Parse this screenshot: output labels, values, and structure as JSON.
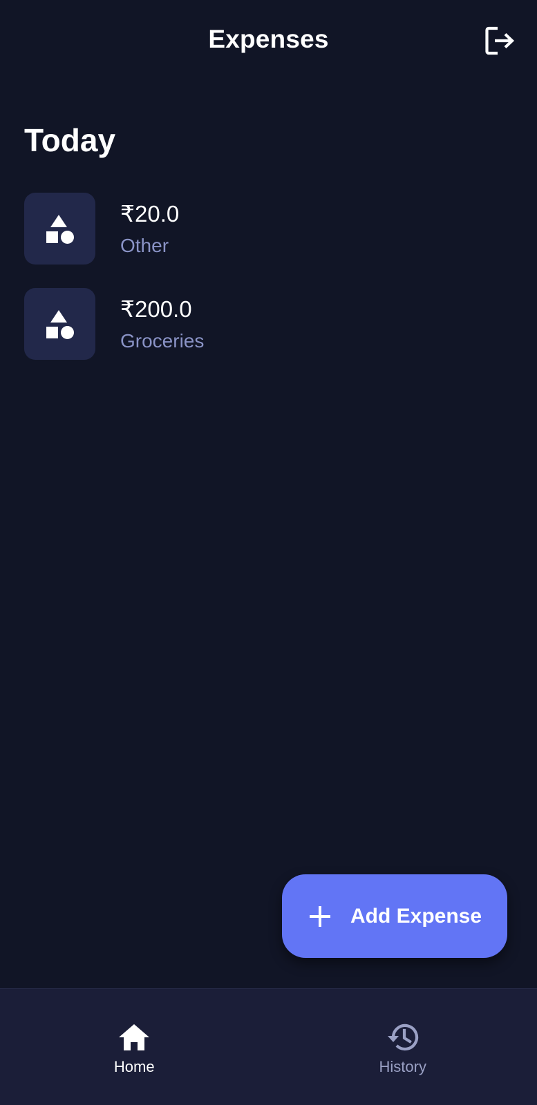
{
  "appbar": {
    "title": "Expenses",
    "logout_icon": "logout-icon"
  },
  "section": {
    "title": "Today"
  },
  "expenses": [
    {
      "amount": "₹20.0",
      "category": "Other",
      "icon": "category-shapes-icon"
    },
    {
      "amount": "₹200.0",
      "category": "Groceries",
      "icon": "category-shapes-icon"
    }
  ],
  "fab": {
    "label": "Add Expense",
    "icon": "plus-icon"
  },
  "bottom_nav": {
    "items": [
      {
        "label": "Home",
        "icon": "home-icon",
        "active": true
      },
      {
        "label": "History",
        "icon": "history-icon",
        "active": false
      }
    ]
  },
  "colors": {
    "background": "#111526",
    "tile": "#22284a",
    "accent": "#6275f5",
    "nav_background": "#1b1e38",
    "secondary_text": "#8a93c6",
    "inactive_nav": "#9aa0c4"
  }
}
